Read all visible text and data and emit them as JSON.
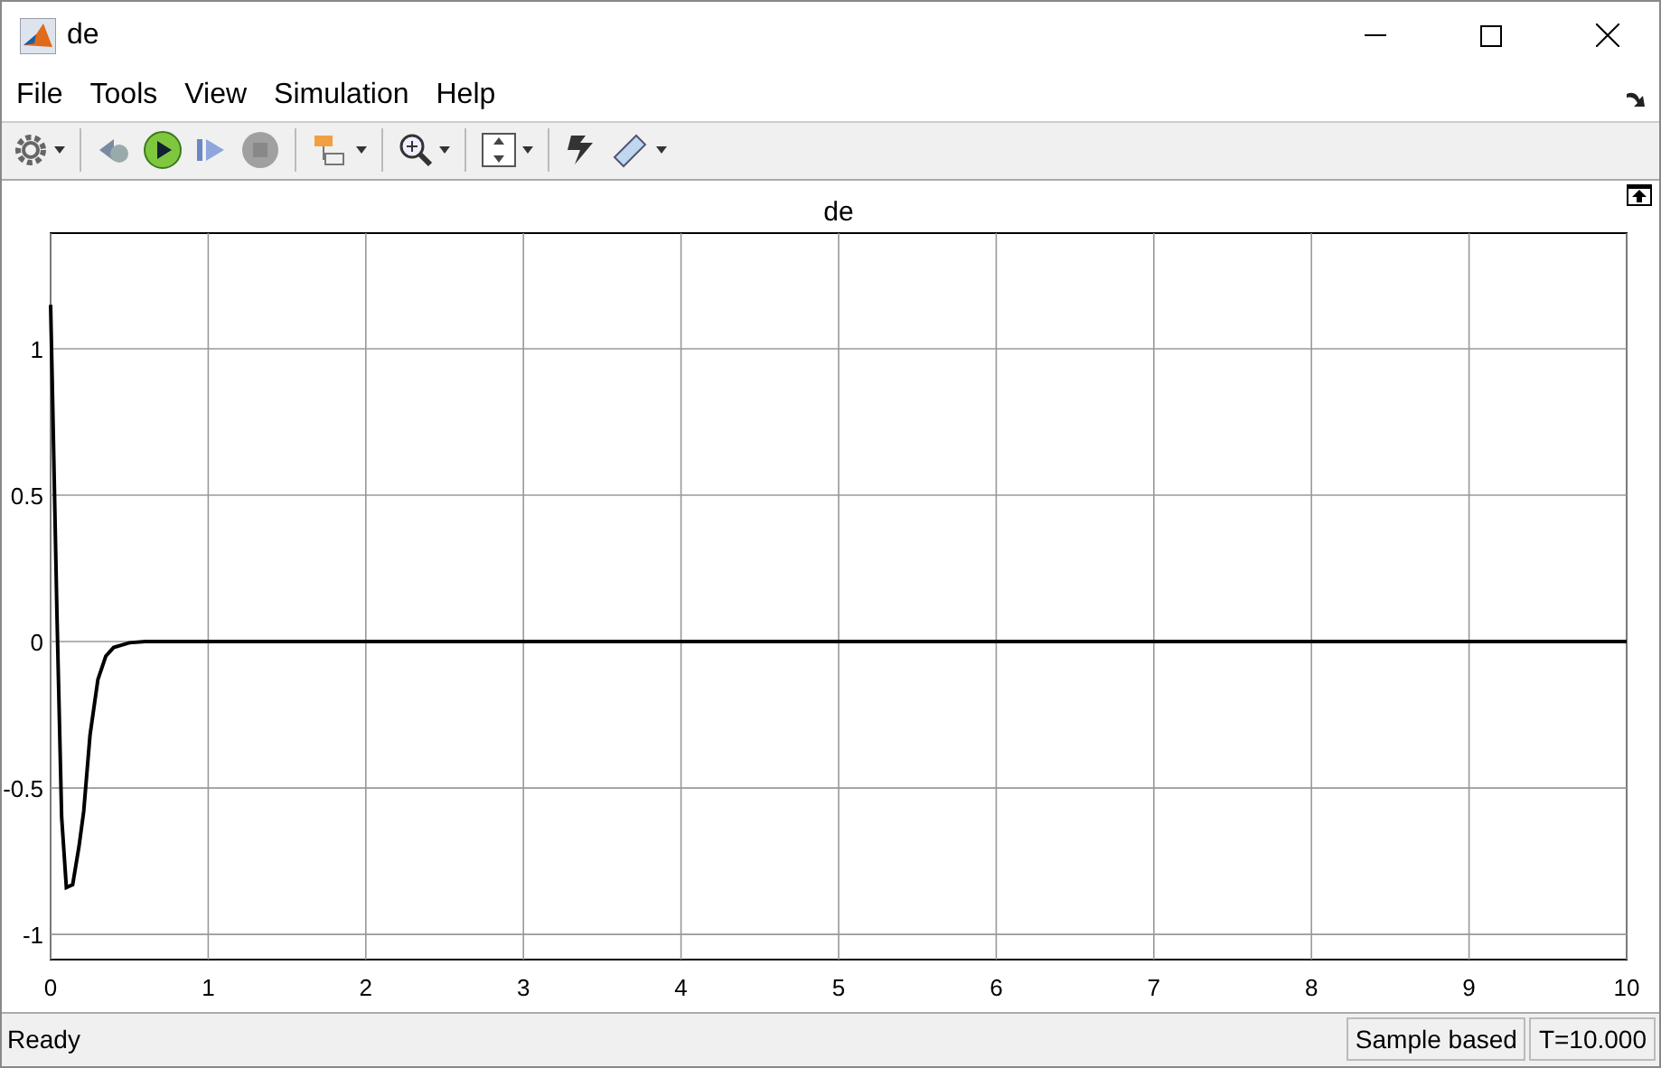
{
  "window": {
    "title": "de"
  },
  "menu": [
    {
      "label": "File"
    },
    {
      "label": "Tools"
    },
    {
      "label": "View"
    },
    {
      "label": "Simulation"
    },
    {
      "label": "Help"
    }
  ],
  "plot": {
    "chart_data": {
      "type": "line",
      "title": "de",
      "xlim": [
        0,
        10
      ],
      "ylim": [
        -1.086,
        1.395
      ],
      "xticks": [
        0,
        1,
        2,
        3,
        4,
        5,
        6,
        7,
        8,
        9,
        10
      ],
      "yticks": [
        -1,
        -0.5,
        0,
        0.5,
        1
      ],
      "x": [
        0,
        0.01,
        0.04,
        0.07,
        0.1,
        0.14,
        0.18,
        0.21,
        0.25,
        0.3,
        0.35,
        0.4,
        0.5,
        0.6,
        1,
        10
      ],
      "grid": true,
      "series": [
        {
          "color": "#000000",
          "values": [
            1.15,
            0.9,
            0.1,
            -0.6,
            -0.84,
            -0.83,
            -0.7,
            -0.58,
            -0.32,
            -0.13,
            -0.05,
            -0.02,
            -0.004,
            0,
            0,
            0
          ]
        }
      ]
    }
  },
  "status_bar": {
    "message": "Ready",
    "mode": "Sample based",
    "time": "T=10.000"
  }
}
